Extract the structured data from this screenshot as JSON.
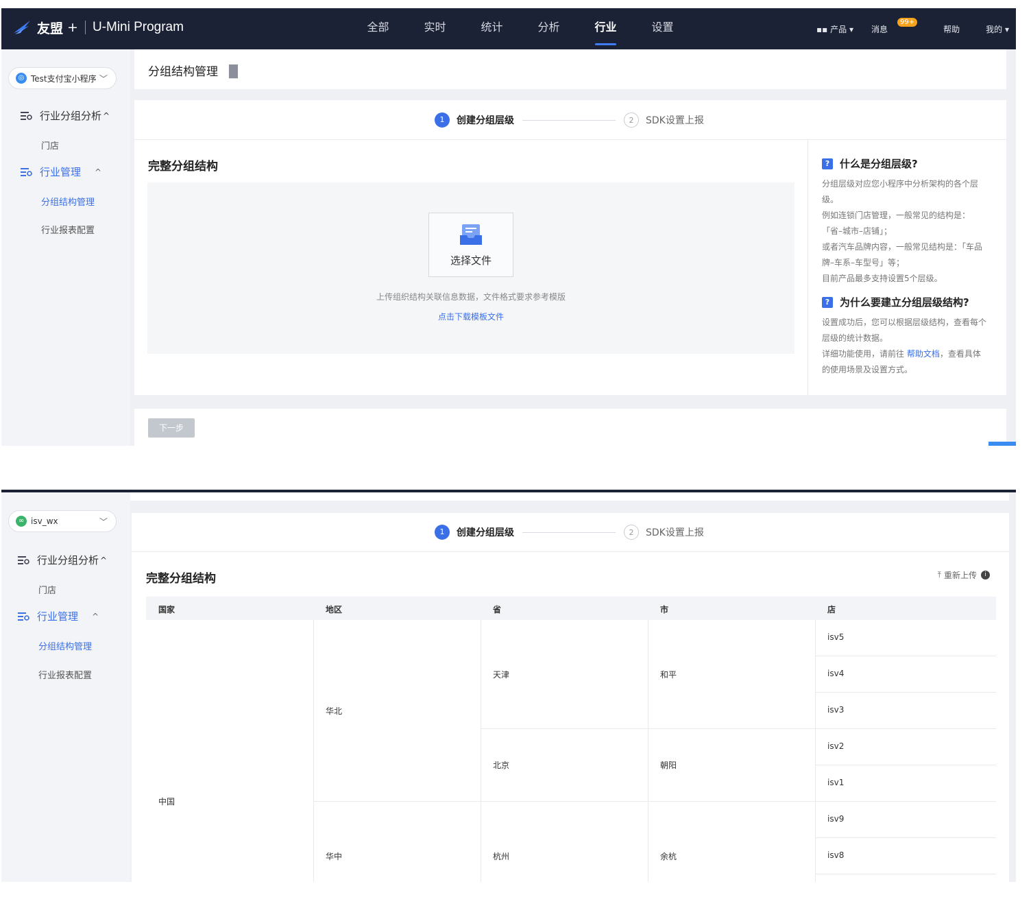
{
  "nav": {
    "brand": "友盟",
    "plus": "+",
    "product": "U-Mini Program",
    "tabs": [
      "全部",
      "实时",
      "统计",
      "分析",
      "行业",
      "设置"
    ],
    "active_tab": "行业",
    "right": {
      "products": "产品",
      "messages": "消息",
      "message_badge": "99+",
      "help": "帮助",
      "mine": "我的"
    }
  },
  "screen1": {
    "app_selector": "Test支付宝小程序",
    "menu": {
      "group1": "行业分组分析",
      "group1_sub": "门店",
      "group2": "行业管理",
      "group2_items": [
        "分组结构管理",
        "行业报表配置"
      ]
    },
    "page_title": "分组结构管理",
    "steps": [
      {
        "num": "1",
        "label": "创建分组层级"
      },
      {
        "num": "2",
        "label": "SDK设置上报"
      }
    ],
    "section_title": "完整分组结构",
    "upload": {
      "button": "选择文件",
      "tip": "上传组织结构关联信息数据，文件格式要求参考模版",
      "download": "点击下载模板文件"
    },
    "help": {
      "q1": "什么是分组层级?",
      "a1": [
        "分组层级对应您小程序中分析架构的各个层",
        "级。",
        "例如连锁门店管理，一般常见的结构是：",
        "「省–城市–店铺」；",
        "或者汽车品牌内容，一般常见结构是：「车品",
        "牌–车系–车型号」等；",
        "目前产品最多支持设置5个层级。"
      ],
      "q2": "为什么要建立分组层级结构?",
      "a2": [
        "设置成功后，您可以根据层级结构，查看每个",
        "层级的统计数据。"
      ],
      "a2_prefix": "详细功能使用，请前往",
      "a2_link": "帮助文档",
      "a2_suffix": "，查看具体",
      "a2_tail": "的使用场景及设置方式。"
    },
    "next_button": "下一步"
  },
  "screen2": {
    "app_selector": "isv_wx",
    "menu": {
      "group1": "行业分组分析",
      "group1_sub": "门店",
      "group2": "行业管理",
      "group2_items": [
        "分组结构管理",
        "行业报表配置"
      ]
    },
    "steps": [
      {
        "num": "1",
        "label": "创建分组层级"
      },
      {
        "num": "2",
        "label": "SDK设置上报"
      }
    ],
    "section_title": "完整分组结构",
    "reupload": "重新上传",
    "table": {
      "headers": [
        "国家",
        "地区",
        "省",
        "市",
        "店"
      ],
      "country": "中国",
      "regions": [
        "华北",
        "华中"
      ],
      "provinces": [
        "天津",
        "北京",
        "杭州"
      ],
      "cities": [
        "和平",
        "朝阳",
        "余杭"
      ],
      "stores": [
        "isv5",
        "isv4",
        "isv3",
        "isv2",
        "isv1",
        "isv9",
        "isv8"
      ]
    }
  },
  "colors": {
    "nav_bg": "#1c2236",
    "accent": "#3a6fe8",
    "badge": "#f7a21b"
  }
}
